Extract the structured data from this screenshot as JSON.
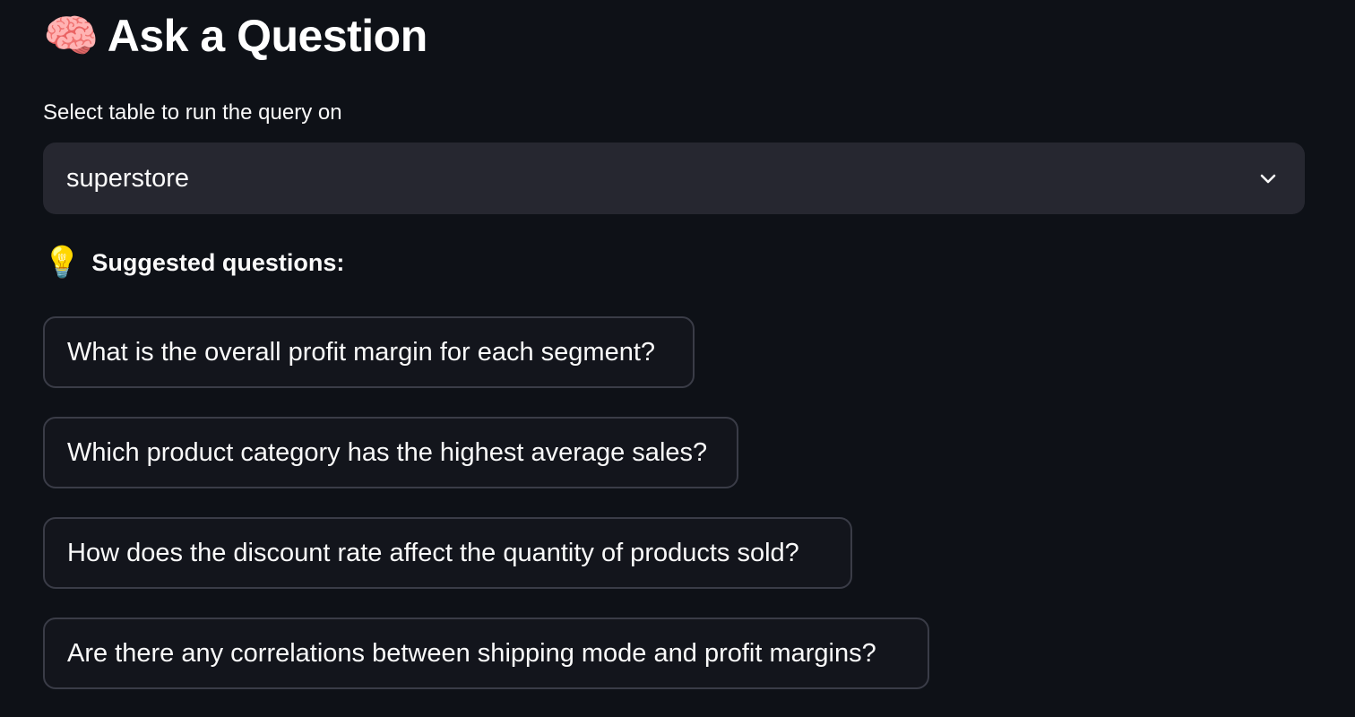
{
  "header": {
    "icon": "brain-icon",
    "icon_glyph": "🧠",
    "title": "Ask a Question"
  },
  "table_select": {
    "label": "Select table to run the query on",
    "value": "superstore",
    "icon": "chevron-down-icon"
  },
  "suggestions": {
    "icon": "light-bulb-icon",
    "icon_glyph": "💡",
    "heading": "Suggested questions:",
    "questions": [
      "What is the overall profit margin for each segment?",
      "Which product category has the highest average sales?",
      "How does the discount rate affect the quantity of products sold?",
      "Are there any correlations between shipping mode and profit margins?"
    ]
  },
  "colors": {
    "background": "#0e1117",
    "select_bg": "#262730",
    "button_border": "#3a3c47",
    "text": "#fafafa"
  }
}
